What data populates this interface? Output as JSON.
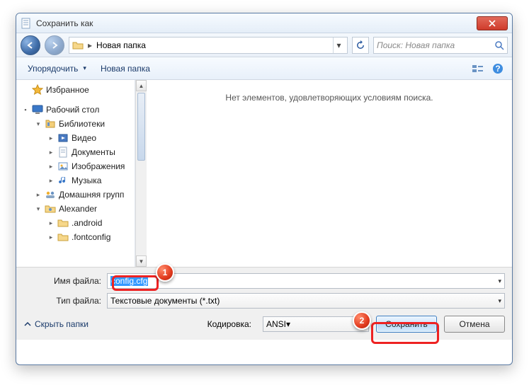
{
  "window": {
    "title": "Сохранить как"
  },
  "nav": {
    "breadcrumb": "Новая папка",
    "search_placeholder": "Поиск: Новая папка"
  },
  "toolbar": {
    "organize": "Упорядочить",
    "new_folder": "Новая папка"
  },
  "tree": {
    "favorites": "Избранное",
    "desktop": "Рабочий стол",
    "libraries": "Библиотеки",
    "video": "Видео",
    "documents": "Документы",
    "images": "Изображения",
    "music": "Музыка",
    "homegroup": "Домашняя групп",
    "user": "Alexander",
    "f1": ".android",
    "f2": ".fontconfig"
  },
  "content": {
    "empty": "Нет элементов, удовлетворяющих условиям поиска."
  },
  "fields": {
    "filename_label": "Имя файла:",
    "filename_value": "config.cfg",
    "filetype_label": "Тип файла:",
    "filetype_value": "Текстовые документы (*.txt)"
  },
  "footer": {
    "hide_folders": "Скрыть папки",
    "encoding_label": "Кодировка:",
    "encoding_value": "ANSI",
    "save": "Сохранить",
    "cancel": "Отмена"
  },
  "callouts": {
    "one": "1",
    "two": "2"
  }
}
